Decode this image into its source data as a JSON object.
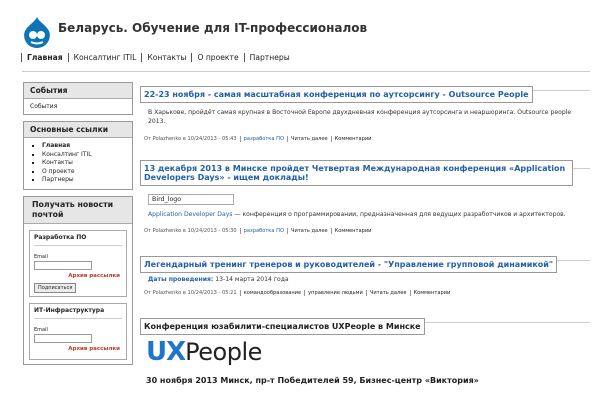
{
  "site": {
    "name": "Беларусь. Обучение для IT-профессионалов"
  },
  "nav": [
    "Главная",
    "Консалтинг ITIL",
    "Контакты",
    "О проекте",
    "Партнеры"
  ],
  "sidebar": {
    "events": {
      "title": "События",
      "link": "События"
    },
    "links": {
      "title": "Основные ссылки",
      "items": [
        "Главная",
        "Консалтинг ITIL",
        "Контакты",
        "О проекте",
        "Партнеры"
      ]
    },
    "subscribe": {
      "title": "Получать новости почтой",
      "lists": [
        {
          "title": "Разработка ПО",
          "email_label": "Email",
          "archive": "Архив рассылки",
          "button": "Подписаться"
        },
        {
          "title": "ИТ-Инфраструктура",
          "email_label": "Email",
          "archive": "Архив рассылки"
        }
      ]
    }
  },
  "posts": [
    {
      "title": "22-23 ноября - самая масштабная конференция по аутсорсингу - Outsource People",
      "body": "В Харькове, пройдёт самая крупная в Восточной Европе двухдневная конференция аутсорсинга и неаршоринга. Outsource people 2013.",
      "meta": {
        "author": "От Polazhenko в 10/24/2013 - 05:43",
        "tags": [
          "разработка ПО"
        ],
        "read": "Читать далее",
        "comments": "Комментарии"
      }
    },
    {
      "title": "13 декабря 2013 в Минске пройдет Четвертая Международная конференция «Application Developers Days» - ищем доклады!",
      "image_alt": "Bird_logo",
      "body_link": "Application Developer Days",
      "body": " — конференция о программировании, предназначенная для ведущих разработчиков и архитекторов.",
      "meta": {
        "author": "От Polazhenko в 10/24/2013 - 05:30",
        "tags": [
          "разработка ПО"
        ],
        "read": "Читать далее",
        "comments": "Комментарии"
      }
    },
    {
      "title": "Легендарный тренинг тренеров и руководителей - \"Управление групповой динамикой\"",
      "date_label": "Даты проведения:",
      "date_value": " 13-14 марта 2014 года",
      "meta": {
        "author": "От Polazhenko в 10/24/2013 - 05:21",
        "tags": [
          "командообразование",
          "управление людьми"
        ],
        "read": "Читать далее",
        "comments": "Комментарии"
      }
    },
    {
      "title": "Конференция юзабилити-специалистов UXPeople в Минске",
      "logo": {
        "ux": "UX",
        "people": "People"
      },
      "event_line": "30 ноября 2013 Минск, пр-т Победителей 59, Бизнес-центр «Виктория»"
    }
  ],
  "colors": {
    "link": "#2460a8",
    "ux_blue": "#1f75c9",
    "archive_red": "#c0392b",
    "drupal_blue": "#0d74b8"
  }
}
